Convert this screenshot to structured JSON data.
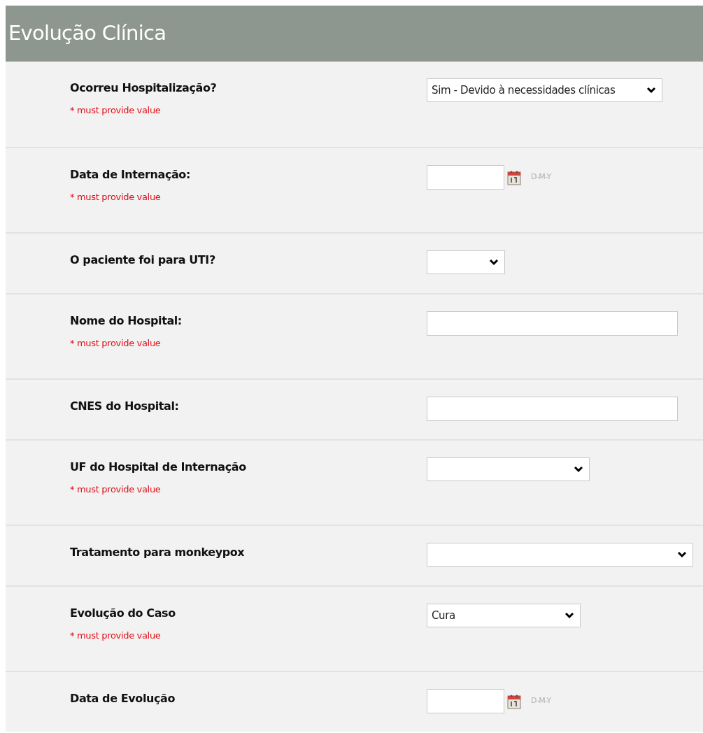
{
  "section": {
    "title": "Evolução Clínica"
  },
  "fields": [
    {
      "label": "Ocorreu Hospitalização?",
      "required_note": "* must provide value",
      "kind": "select",
      "value": "Sim - Devido à necessidades clínicas"
    },
    {
      "label": "Data de Internação:",
      "required_note": "* must provide value",
      "kind": "date",
      "hint": "D-M-Y"
    },
    {
      "label": "O paciente foi para UTI?",
      "kind": "select"
    },
    {
      "label": "Nome do Hospital:",
      "required_note": "* must provide value",
      "kind": "text"
    },
    {
      "label": "CNES do Hospital:",
      "kind": "text"
    },
    {
      "label": "UF do Hospital de Internação",
      "required_note": "* must provide value",
      "kind": "select"
    },
    {
      "label": "Tratamento para monkeypox",
      "kind": "select"
    },
    {
      "label": "Evolução do Caso",
      "required_note": "* must provide value",
      "kind": "select",
      "value": "Cura"
    },
    {
      "label": "Data de Evolução",
      "kind": "date",
      "hint": "D-M-Y"
    }
  ]
}
